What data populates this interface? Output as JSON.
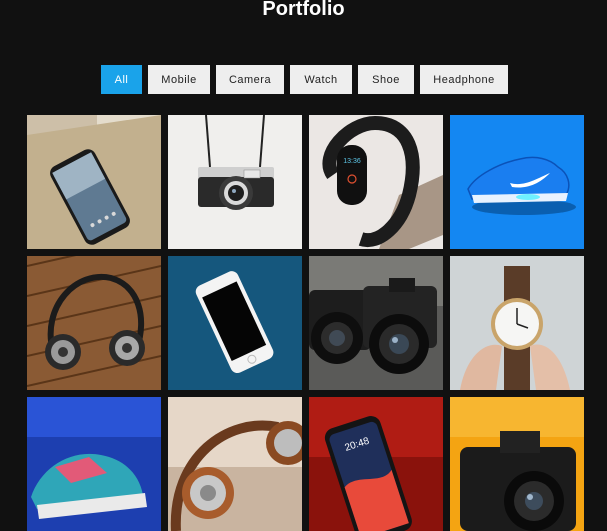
{
  "page": {
    "title": "Portfolio"
  },
  "filters": [
    {
      "label": "All",
      "active": true
    },
    {
      "label": "Mobile",
      "active": false
    },
    {
      "label": "Camera",
      "active": false
    },
    {
      "label": "Watch",
      "active": false
    },
    {
      "label": "Shoe",
      "active": false
    },
    {
      "label": "Headphone",
      "active": false
    }
  ],
  "colors": {
    "accent": "#1aa3ea",
    "background": "#111111",
    "filter_bg": "#eeeeee"
  },
  "gallery": [
    {
      "subject": "smartphone-on-desk"
    },
    {
      "subject": "film-camera-with-strap"
    },
    {
      "subject": "fitness-band"
    },
    {
      "subject": "blue-sneaker"
    },
    {
      "subject": "headphones-on-wood"
    },
    {
      "subject": "smartphone-on-blue"
    },
    {
      "subject": "dslr-cameras"
    },
    {
      "subject": "wristwatch-in-hand"
    },
    {
      "subject": "sneakers"
    },
    {
      "subject": "headphones-closeup"
    },
    {
      "subject": "red-smartphone"
    },
    {
      "subject": "camera-on-yellow"
    }
  ],
  "phone_screen": {
    "time": "20:48"
  },
  "band_screen": {
    "time": "13:36"
  }
}
